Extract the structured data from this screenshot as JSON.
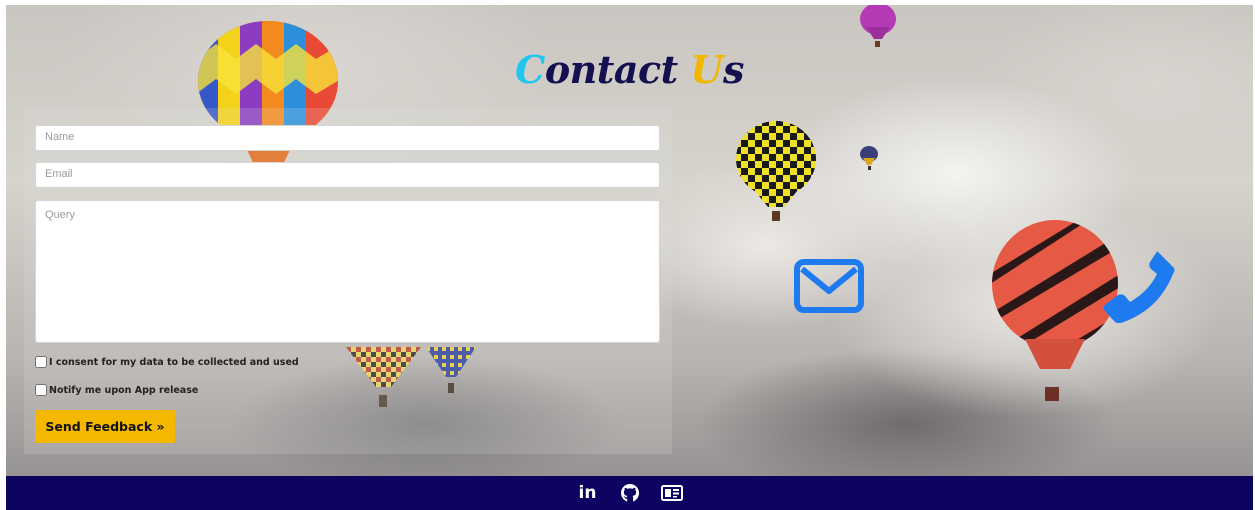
{
  "page": {
    "title_first_letter": "C",
    "title_mid": "ontact ",
    "title_second_letter": "U",
    "title_end": "s"
  },
  "form": {
    "name_placeholder": "Name",
    "email_placeholder": "Email",
    "query_placeholder": "Query",
    "consent_label": "I consent for my data to be collected and used",
    "notify_label": "Notify me upon App release",
    "send_label": "Send Feedback »"
  },
  "contact_icons": [
    "envelope-icon",
    "phone-icon"
  ],
  "footer": {
    "icons": [
      "linkedin-icon",
      "github-icon",
      "contact-card-icon"
    ],
    "linkedin_text": "in"
  },
  "colors": {
    "title_main": "#14104f",
    "title_accent_cyan": "#1ec6f0",
    "title_accent_gold": "#f1b600",
    "button_bg": "#f5b800",
    "contact_icon_blue": "#1e7bef",
    "footer_bg": "#0d0360"
  }
}
